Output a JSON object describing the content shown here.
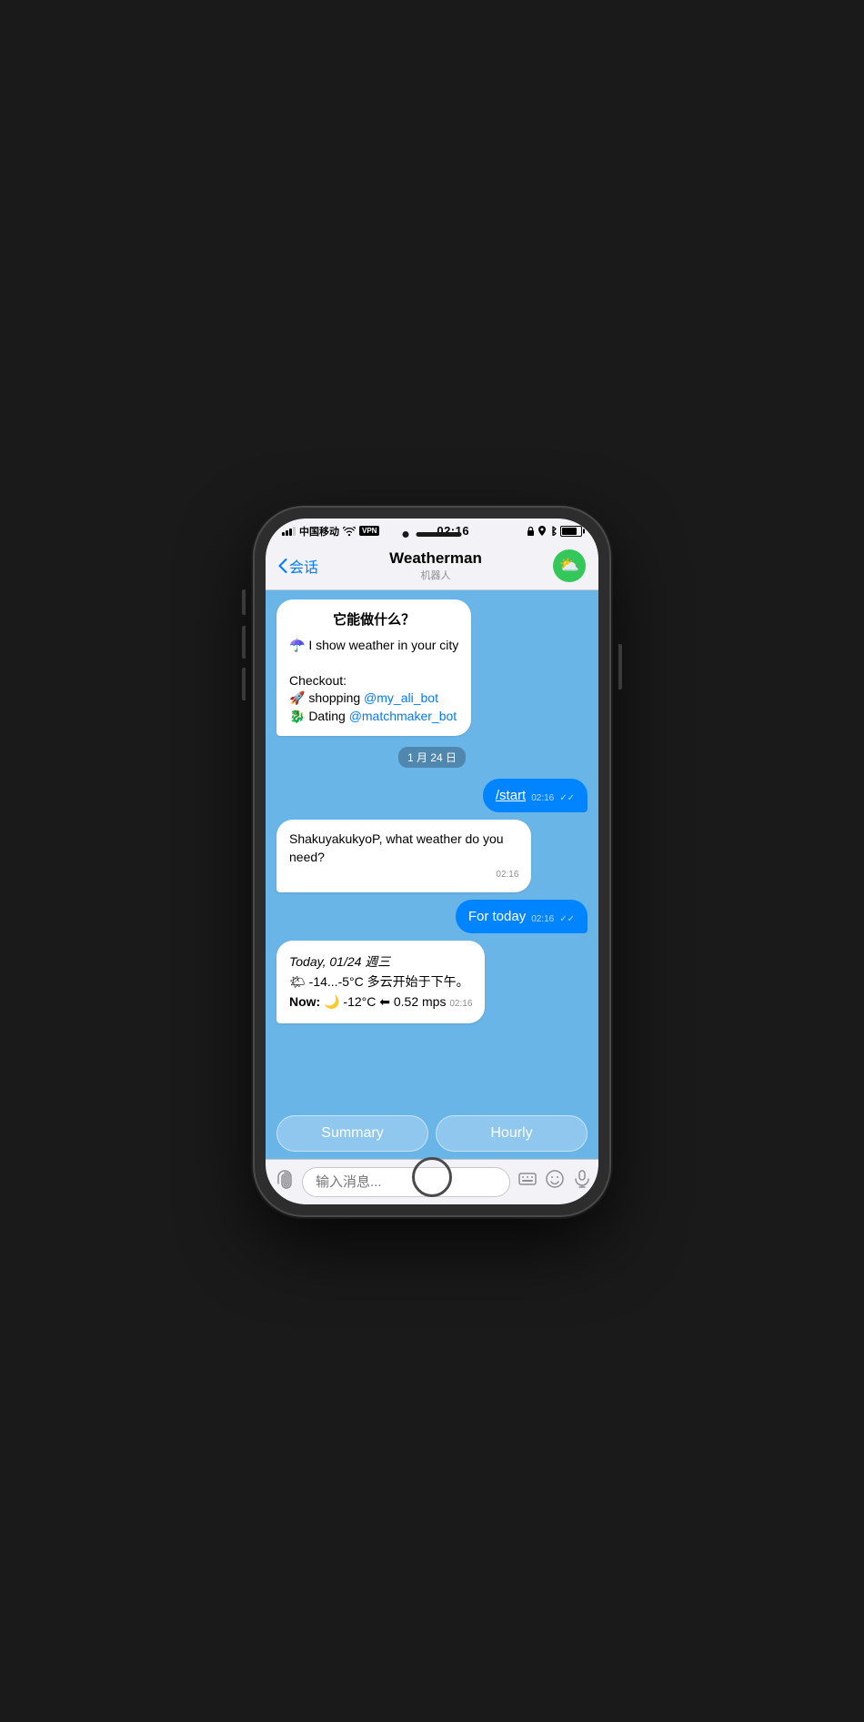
{
  "status": {
    "carrier": "中国移动",
    "wifi": "WiFi",
    "vpn": "VPN",
    "time": "02:16",
    "battery_pct": 80
  },
  "nav": {
    "back_label": "‹ 会话",
    "title": "Weatherman",
    "subtitle": "机器人"
  },
  "messages": [
    {
      "type": "bot",
      "id": "intro",
      "title": "它能做什么？",
      "lines": [
        "☂️ I show weather in your city",
        "",
        "Checkout:",
        "🚀 shopping @my_ali_bot",
        "🐉 Dating @matchmaker_bot"
      ]
    },
    {
      "type": "date",
      "label": "1 月 24 日"
    },
    {
      "type": "user",
      "text": "/start",
      "time": "02:16",
      "ticks": "✓✓"
    },
    {
      "type": "bot",
      "id": "question",
      "text": "ShakuyakukyoP, what weather do you need?",
      "time": "02:16"
    },
    {
      "type": "user",
      "text": "For today",
      "time": "02:16",
      "ticks": "✓✓"
    },
    {
      "type": "bot",
      "id": "weather",
      "date_line": "Today, 01/24 週三",
      "weather_line": "🌤 -14...-5°C 多云开始于下午。",
      "now_line": "Now: 🌙 -12°C ⬅ 0.52 mps",
      "time": "02:16"
    }
  ],
  "quick_replies": [
    {
      "label": "Summary"
    },
    {
      "label": "Hourly"
    }
  ],
  "input": {
    "placeholder": "输入消息..."
  }
}
